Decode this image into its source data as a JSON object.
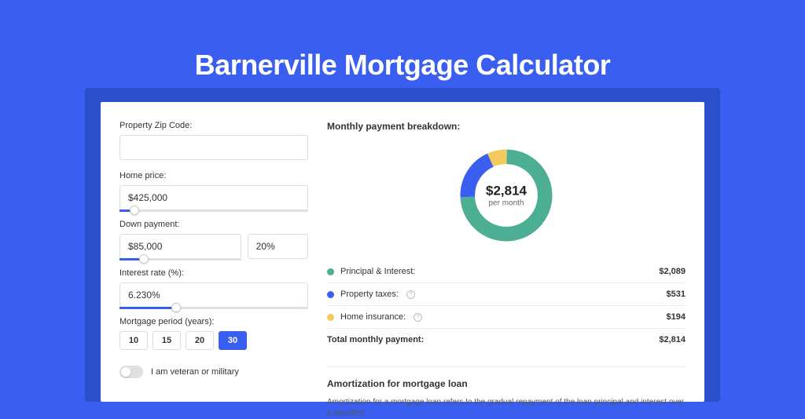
{
  "title": "Barnerville Mortgage Calculator",
  "form": {
    "zip": {
      "label": "Property Zip Code:",
      "value": ""
    },
    "home_price": {
      "label": "Home price:",
      "value": "$425,000",
      "slider_pct": 8
    },
    "down_payment": {
      "label": "Down payment:",
      "value": "$85,000",
      "pct_value": "20%",
      "slider_pct": 20
    },
    "interest": {
      "label": "Interest rate (%):",
      "value": "6.230%",
      "slider_pct": 30
    },
    "period": {
      "label": "Mortgage period (years):",
      "options": [
        "10",
        "15",
        "20",
        "30"
      ],
      "selected": "30"
    },
    "veteran": {
      "label": "I am veteran or military",
      "on": false
    }
  },
  "breakdown": {
    "title": "Monthly payment breakdown:",
    "center_value": "$2,814",
    "center_label": "per month",
    "items": [
      {
        "label": "Principal & Interest:",
        "value": "$2,089",
        "color": "green",
        "info": false
      },
      {
        "label": "Property taxes:",
        "value": "$531",
        "color": "blue",
        "info": true
      },
      {
        "label": "Home insurance:",
        "value": "$194",
        "color": "yellow",
        "info": true
      }
    ],
    "total_label": "Total monthly payment:",
    "total_value": "$2,814"
  },
  "amortization": {
    "title": "Amortization for mortgage loan",
    "text": "Amortization for a mortgage loan refers to the gradual repayment of the loan principal and interest over a specified"
  },
  "chart_data": {
    "type": "pie",
    "title": "Monthly payment breakdown",
    "series": [
      {
        "name": "Principal & Interest",
        "value": 2089,
        "color": "#4caf94"
      },
      {
        "name": "Property taxes",
        "value": 531,
        "color": "#3a5ff0"
      },
      {
        "name": "Home insurance",
        "value": 194,
        "color": "#f4c95d"
      }
    ],
    "total": 2814,
    "unit": "USD per month"
  },
  "colors": {
    "accent": "#3a5ff0",
    "green": "#4caf94",
    "blue": "#3a5ff0",
    "yellow": "#f4c95d"
  }
}
